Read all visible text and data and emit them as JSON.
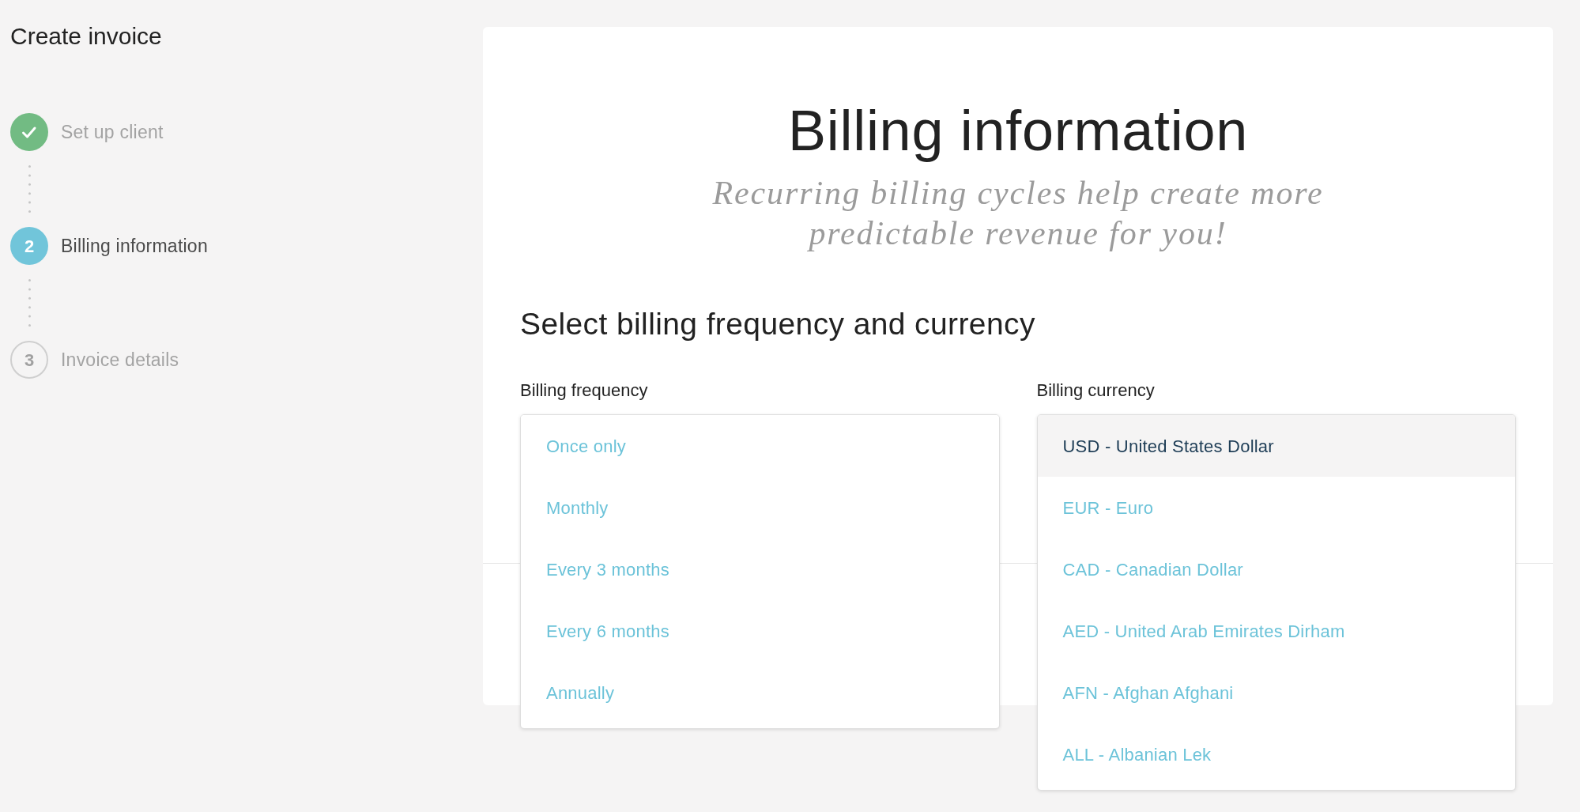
{
  "sidebar": {
    "title": "Create invoice",
    "steps": [
      {
        "label": "Set up client",
        "completed": true,
        "selected": false
      },
      {
        "number": "2",
        "label": "Billing information",
        "completed": false,
        "selected": true
      },
      {
        "number": "3",
        "label": "Invoice details",
        "completed": false,
        "selected": false
      }
    ]
  },
  "card": {
    "title": "Billing information",
    "subtitle": "Recurring billing cycles help create more predictable revenue for you!",
    "section_title": "Select billing frequency and currency",
    "fields": [
      {
        "label": "Billing frequency",
        "options": [
          {
            "label": "Once only",
            "selected": false
          },
          {
            "label": "Monthly",
            "selected": false
          },
          {
            "label": "Every 3 months",
            "selected": false
          },
          {
            "label": "Every 6 months",
            "selected": false
          },
          {
            "label": "Annually",
            "selected": false
          }
        ]
      },
      {
        "label": "Billing currency",
        "options": [
          {
            "label": "USD - United States Dollar",
            "selected": true
          },
          {
            "label": "EUR - Euro",
            "selected": false
          },
          {
            "label": "CAD - Canadian Dollar",
            "selected": false
          },
          {
            "label": "AED - United Arab Emirates Dirham",
            "selected": false
          },
          {
            "label": "AFN - Afghan Afghani",
            "selected": false
          },
          {
            "label": "ALL - Albanian Lek",
            "selected": false
          }
        ]
      }
    ]
  }
}
